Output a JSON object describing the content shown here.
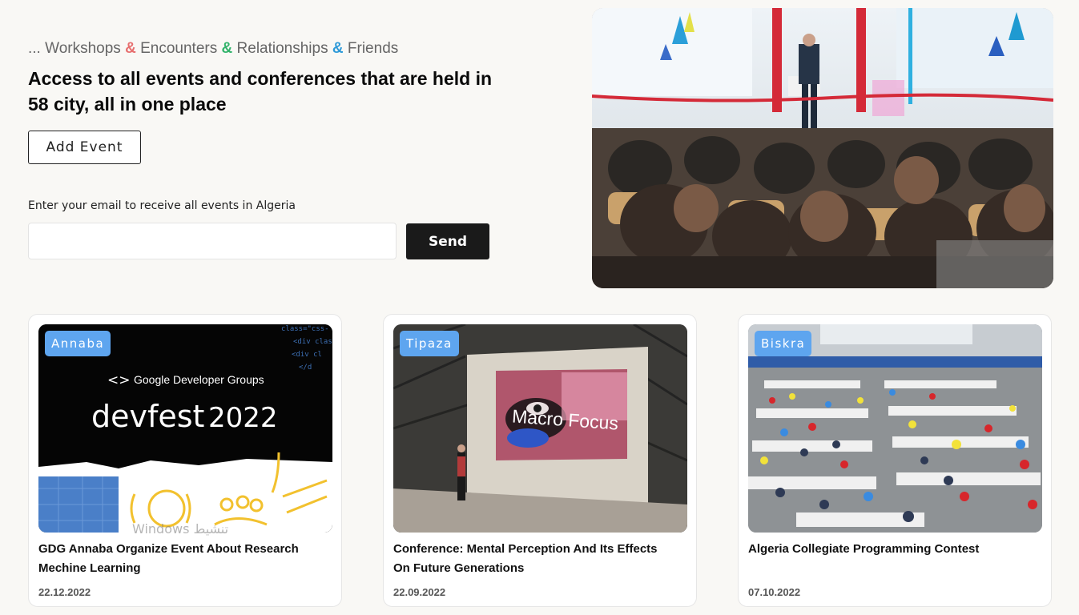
{
  "hero": {
    "tagline": {
      "prefix": "... ",
      "items": [
        "Workshops",
        "Encounters",
        "Relationships",
        "Friends"
      ],
      "amp": "&",
      "amp_colors": [
        "#e76f6f",
        "#33b36b",
        "#2f9ad8"
      ]
    },
    "headline": "Access to all events and conferences that are held in 58 city, all in one place",
    "add_event_label": "Add Event",
    "email_label": "Enter your email to receive all events in Algeria",
    "email_value": "",
    "send_label": "Send"
  },
  "events": [
    {
      "city": "Annaba",
      "title": "GDG Annaba Organize Event About Research Mechine Learning",
      "date": "22.12.2022",
      "image_text": {
        "gdg": "Google Developer Groups",
        "devfest": "devfest",
        "year": "2022"
      }
    },
    {
      "city": "Tipaza",
      "title": "Conference: Mental Perception And Its Effects On Future Generations",
      "date": "22.09.2022",
      "image_text": {
        "screen": "Macro Focus"
      }
    },
    {
      "city": "Biskra",
      "title": "Algeria Collegiate Programming Contest",
      "date": "07.10.2022"
    }
  ],
  "watermark": "Windows تنشيط",
  "colors": {
    "badge": "#5ea5ef",
    "send_bg": "#1a1a1a",
    "page_bg": "#f9f8f5"
  }
}
